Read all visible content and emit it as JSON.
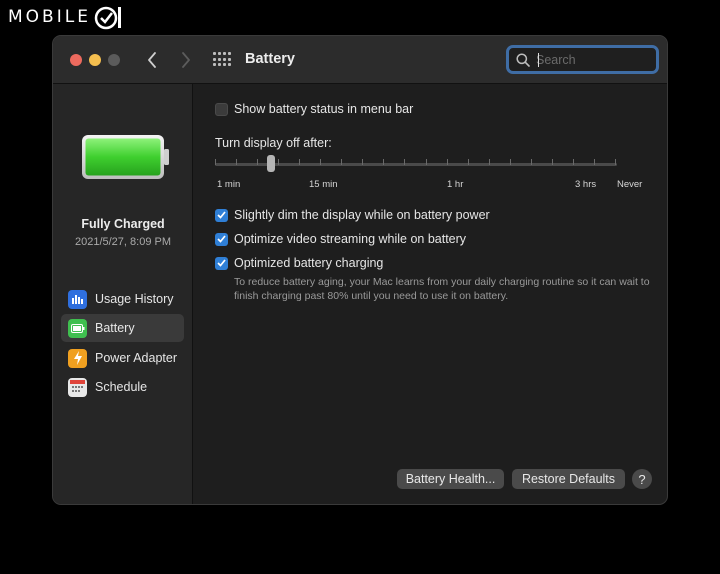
{
  "watermark": {
    "text": "MOBILE"
  },
  "window": {
    "title": "Battery",
    "search": {
      "placeholder": "Search",
      "value": ""
    }
  },
  "sidebar": {
    "status_title": "Fully Charged",
    "status_date": "2021/5/27, 8:09 PM",
    "items": [
      {
        "label": "Usage History",
        "icon": "bar-chart-icon",
        "color": "#2f6fde",
        "selected": false
      },
      {
        "label": "Battery",
        "icon": "battery-icon",
        "color": "#3fbf4f",
        "selected": true
      },
      {
        "label": "Power Adapter",
        "icon": "bolt-icon",
        "color": "#f0a020",
        "selected": false
      },
      {
        "label": "Schedule",
        "icon": "calendar-icon",
        "color": "#e8e8e8",
        "selected": false
      }
    ]
  },
  "content": {
    "show_status": {
      "label": "Show battery status in menu bar",
      "checked": false
    },
    "display_off": {
      "label": "Turn display off after:",
      "tick_labels": [
        "1 min",
        "15 min",
        "1 hr",
        "3 hrs",
        "Never"
      ],
      "value": "4 min"
    },
    "dim_display": {
      "label": "Slightly dim the display while on battery power",
      "checked": true
    },
    "optimize_video": {
      "label": "Optimize video streaming while on battery",
      "checked": true
    },
    "optimized_charging": {
      "label": "Optimized battery charging",
      "checked": true,
      "description": "To reduce battery aging, your Mac learns from your daily charging routine so it can wait to finish charging past 80% until you need to use it on battery."
    },
    "buttons": {
      "battery_health": "Battery Health...",
      "restore_defaults": "Restore Defaults",
      "help": "?"
    }
  },
  "colors": {
    "accent": "#2f7fd6",
    "battery_green": "#3fcf2f",
    "window_bg": "#1e1e1e"
  }
}
